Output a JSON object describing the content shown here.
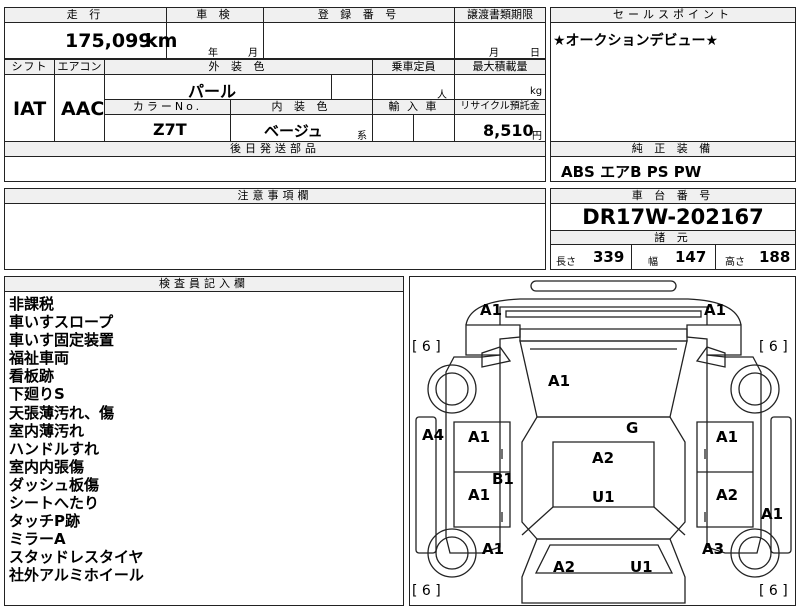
{
  "top": {
    "mileage_label": "走 行",
    "mileage_value": "175,099",
    "mileage_unit": "km",
    "inspection_label": "車 検",
    "inspection_year": "年",
    "inspection_month": "月",
    "registration_label": "登 録 番 号",
    "transfer_label": "譲渡書類期限",
    "transfer_month": "月",
    "transfer_day": "日"
  },
  "sales_point": {
    "header": "セールスポイント",
    "text": "★オークションデビュー★"
  },
  "row2": {
    "shift_label": "シフト",
    "ac_label": "エアコン",
    "exterior_label": "外 装 色",
    "capacity_label": "乗車定員",
    "maxload_label": "最大積載量",
    "shift_value": "IAT",
    "ac_value": "AAC",
    "exterior_value": "パール",
    "capacity_unit": "人",
    "maxload_unit": "kg",
    "color_no_label": "カラーNo.",
    "interior_label": "内 装 色",
    "import_label": "輸 入 車",
    "recycle_label": "リサイクル預託金",
    "color_no_value": "Z7T",
    "interior_value": "ベージュ",
    "interior_suffix": "系",
    "recycle_value": "8,510",
    "recycle_unit": "円"
  },
  "later_parts": {
    "header": "後日発送部品"
  },
  "genuine_equipment": {
    "header": "純 正 装 備",
    "value": "ABS エアB PS PW"
  },
  "notes": {
    "header": "注意事項欄"
  },
  "chassis": {
    "header": "車 台 番 号",
    "value": "DR17W-202167"
  },
  "specs": {
    "header": "諸 元",
    "length_label": "長さ",
    "length_value": "339",
    "width_label": "幅",
    "width_value": "147",
    "height_label": "高さ",
    "height_value": "188"
  },
  "inspector": {
    "header": "検査員記入欄",
    "items": [
      "非課税",
      "車いすスロープ",
      "車いす固定装置",
      "福祉車両",
      "看板跡",
      "下廻りS",
      "天張薄汚れ、傷",
      "室内薄汚れ",
      "ハンドルすれ",
      "室内内張傷",
      "ダッシュ板傷",
      "シートへたり",
      "タッチP跡",
      "ミラーA",
      "スタッドレスタイヤ",
      "社外アルミホイール"
    ]
  },
  "diagram": {
    "tire_left": "[ 6 ]",
    "tire_right": "[ 6 ]",
    "tire_bl": "[ 6 ]",
    "tire_br": "[ 6 ]",
    "marks": {
      "front_left": "A1",
      "front_right": "A1",
      "hood": "A1",
      "left_side": "A4",
      "right_side": "A1",
      "door_fl": "A1",
      "door_fr": "A1",
      "glass": "G",
      "roof_front": "A2",
      "pillar": "B1",
      "roof_rear": "U1",
      "door_rl": "A1",
      "door_rr": "A2",
      "rear_left": "A1",
      "rear_right": "A3",
      "tail_left": "A2",
      "tail_right": "U1"
    }
  }
}
